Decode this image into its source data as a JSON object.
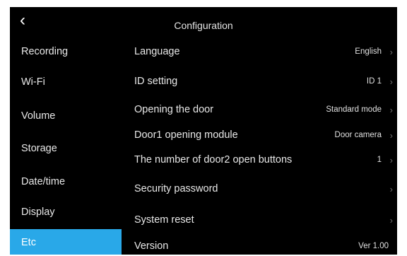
{
  "header": {
    "back_icon": "chevron-left-icon",
    "title": "Configuration"
  },
  "sidebar": {
    "items": [
      {
        "label": "Recording",
        "active": false
      },
      {
        "label": "Wi-Fi",
        "active": false
      },
      {
        "label": "Volume",
        "active": false
      },
      {
        "label": "Storage",
        "active": false
      },
      {
        "label": "Date/time",
        "active": false
      },
      {
        "label": "Display",
        "active": false
      },
      {
        "label": "Etc",
        "active": true
      }
    ],
    "active_color": "#29a8e8"
  },
  "settings": [
    {
      "label": "Language",
      "value": "English",
      "chevron": true
    },
    {
      "label": "ID setting",
      "value": "ID 1",
      "chevron": true
    },
    {
      "label": "Opening the door",
      "value": "Standard mode",
      "chevron": true
    },
    {
      "label": "Door1 opening module",
      "value": "Door camera",
      "chevron": true
    },
    {
      "label": "The number of door2 open buttons",
      "value": "1",
      "chevron": true
    },
    {
      "label": "Security password",
      "value": "",
      "chevron": true
    },
    {
      "label": "System reset",
      "value": "",
      "chevron": true
    },
    {
      "label": "Version",
      "value": "Ver 1.00",
      "chevron": false
    }
  ]
}
